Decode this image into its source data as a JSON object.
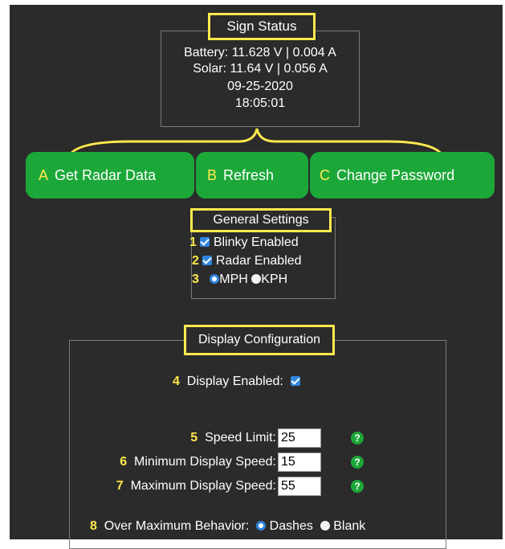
{
  "sign_status": {
    "title": "Sign Status",
    "battery": "Battery: 11.628 V | 0.004 A",
    "solar": "Solar: 11.64 V | 0.056 A",
    "date": "09-25-2020",
    "time": "18:05:01"
  },
  "buttons": [
    {
      "letter": "A",
      "label": "Get Radar Data"
    },
    {
      "letter": "B",
      "label": "Refresh"
    },
    {
      "letter": "C",
      "label": "Change Password"
    }
  ],
  "general_settings": {
    "title": "General Settings",
    "items": [
      {
        "num": "1",
        "label": "Blinky Enabled",
        "checked": true
      },
      {
        "num": "2",
        "label": "Radar Enabled",
        "checked": true
      }
    ],
    "units": {
      "num": "3",
      "option1": "MPH",
      "option2": "KPH",
      "selected": "MPH"
    }
  },
  "display_config": {
    "title": "Display Configuration",
    "display_enabled": {
      "num": "4",
      "label": "Display Enabled:",
      "checked": true
    },
    "speed_limit": {
      "num": "5",
      "label": "Speed Limit:",
      "value": "25"
    },
    "min_speed": {
      "num": "6",
      "label": "Minimum Display Speed:",
      "value": "15"
    },
    "max_speed": {
      "num": "7",
      "label": "Maximum Display Speed:",
      "value": "55"
    },
    "over_max": {
      "num": "8",
      "label": "Over Maximum Behavior:",
      "option1": "Dashes",
      "option2": "Blank",
      "selected": "Dashes"
    },
    "help_glyph": "?"
  },
  "colors": {
    "background": "#2b2b2b",
    "accent_green": "#1ca839",
    "highlight_yellow": "#ffe94d",
    "checkbox_blue": "#2f86e0"
  }
}
